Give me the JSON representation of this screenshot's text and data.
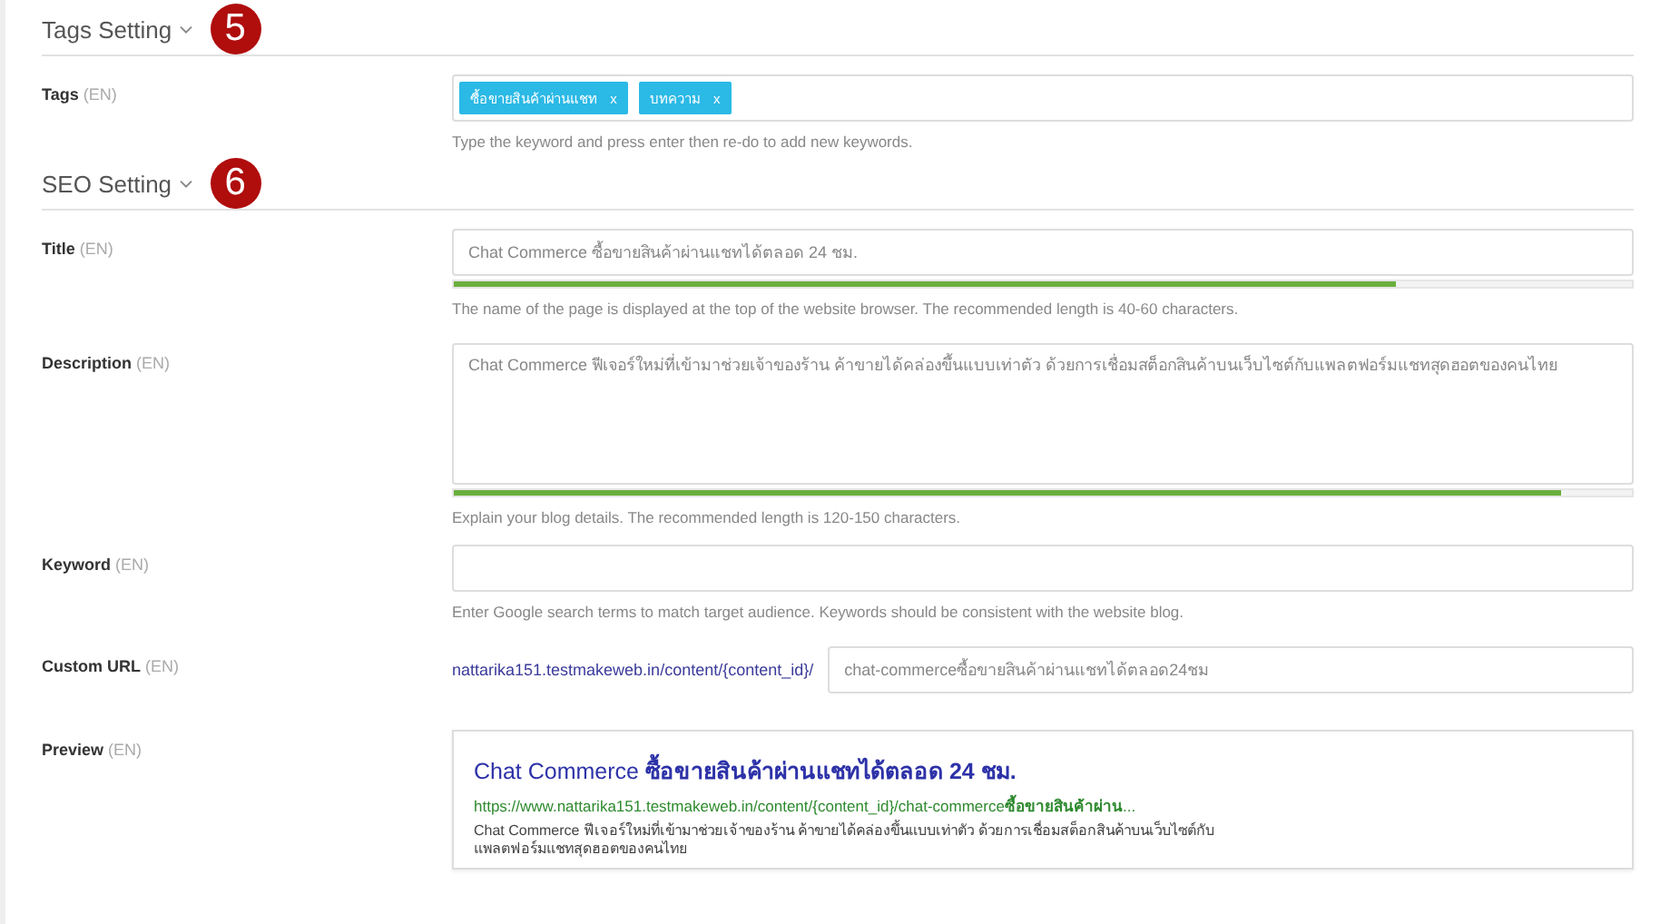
{
  "sections": [
    {
      "title": "Tags Setting",
      "marker": "5",
      "rows": [
        {
          "kind": "tags",
          "label": "Tags",
          "lang": "(EN)",
          "tags": [
            {
              "label": "ซื้อขายสินค้าผ่านแชท",
              "remove": "x"
            },
            {
              "label": "บทความ",
              "remove": "x"
            }
          ],
          "hint": "Type the keyword and press enter then re-do to add new keywords."
        }
      ]
    },
    {
      "title": "SEO Setting",
      "marker": "6",
      "rows": [
        {
          "kind": "input",
          "label": "Title",
          "lang": "(EN)",
          "value": "Chat Commerce ซื้อขายสินค้าผ่านแชทได้ตลอด 24 ชม.",
          "level": 0.8,
          "hint": "The name of the page is displayed at the top of the website browser. The recommended length is 40-60 characters."
        },
        {
          "kind": "textarea",
          "label": "Description",
          "lang": "(EN)",
          "value": "Chat Commerce ฟีเจอร์ใหม่ที่เข้ามาช่วยเจ้าของร้าน ค้าขายได้คล่องขึ้นแบบเท่าตัว ด้วยการเชื่อมสต็อกสินค้าบนเว็บไซต์กับแพลตฟอร์มแชทสุดฮอตของคนไทย",
          "level": 0.94,
          "hint": "Explain your blog details. The recommended length is 120-150 characters."
        },
        {
          "kind": "input",
          "label": "Keyword",
          "lang": "(EN)",
          "hint": "Enter Google search terms to match target audience. Keywords should be consistent with the website blog."
        },
        {
          "kind": "url",
          "label": "Custom URL",
          "lang": "(EN)",
          "prefix": "nattarika151.testmakeweb.in/content/{content_id}/",
          "value": "chat-commerceซื้อขายสินค้าผ่านแชทได้ตลอด24ชม"
        },
        {
          "kind": "preview",
          "label": "Preview",
          "lang": "(EN)",
          "title": "Chat Commerce **ซื้อขายสินค้าผ่านแชทได้ตลอด 24 ชม.**",
          "url": "https://www.nattarika151.testmakeweb.in/content/{content_id}/chat-commerce**ซื้อขายสินค้าผ่าน**...",
          "description": "Chat Commerce ฟีเจอร์ใหม่ที่เข้ามาช่วยเจ้าของร้าน ค้าขายได้คล่องขึ้นแบบเท่าตัว ด้วยการเชื่อมสต็อกสินค้าบนเว็บไซต์กับแพลตฟอร์มแชทสุดฮอตของคนไทย"
        }
      ]
    }
  ]
}
